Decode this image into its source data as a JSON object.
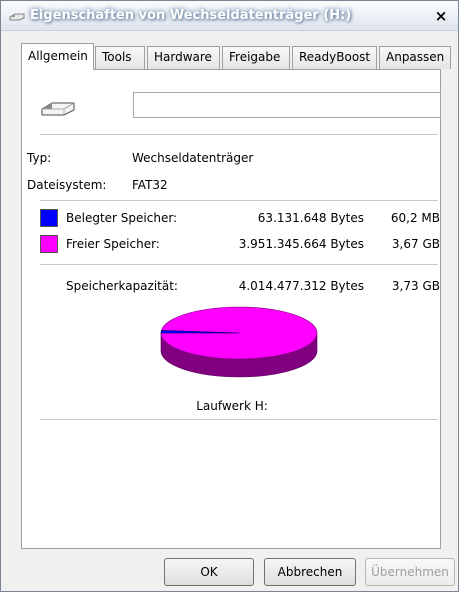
{
  "window": {
    "title": "Eigenschaften von Wechseldatenträger (H:)",
    "close_glyph": "×"
  },
  "tabs": [
    {
      "label": "Allgemein",
      "active": true
    },
    {
      "label": "Tools",
      "active": false
    },
    {
      "label": "Hardware",
      "active": false
    },
    {
      "label": "Freigabe",
      "active": false
    },
    {
      "label": "ReadyBoost",
      "active": false
    },
    {
      "label": "Anpassen",
      "active": false
    }
  ],
  "general": {
    "name_value": "",
    "type_label": "Typ:",
    "type_value": "Wechseldatenträger",
    "fs_label": "Dateisystem:",
    "fs_value": "FAT32"
  },
  "usage": {
    "used_label": "Belegter Speicher:",
    "used_bytes": "63.131.648 Bytes",
    "used_short": "60,2 MB",
    "used_color": "#0000ff",
    "free_label": "Freier Speicher:",
    "free_bytes": "3.951.345.664 Bytes",
    "free_short": "3,67 GB",
    "free_color": "#ff00ff",
    "capacity_label": "Speicherkapazität:",
    "capacity_bytes": "4.014.477.312 Bytes",
    "capacity_short": "3,73 GB",
    "drive_label": "Laufwerk H:",
    "used_fraction": 0.0157
  },
  "buttons": {
    "ok": "OK",
    "cancel": "Abbrechen",
    "apply": "Übernehmen"
  },
  "icons": {
    "app": "drive-icon",
    "drive": "usb-drive-icon",
    "close": "close-icon"
  }
}
